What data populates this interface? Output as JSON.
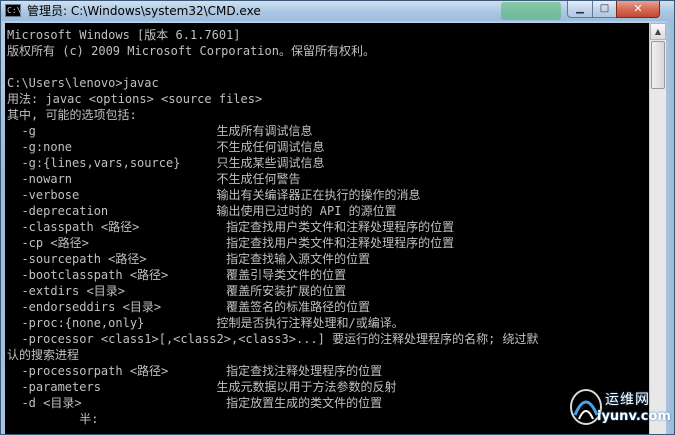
{
  "window": {
    "title": "管理员: C:\\Windows\\system32\\CMD.exe",
    "icon_label": "C:\\",
    "buttons": {
      "minimize_glyph": "▁",
      "maximize_glyph": "□",
      "close_glyph": "✕"
    }
  },
  "console": {
    "lines": [
      "Microsoft Windows [版本 6.1.7601]",
      "版权所有 (c) 2009 Microsoft Corporation。保留所有权利。",
      "",
      "C:\\Users\\lenovo>javac",
      "用法: javac <options> <source files>",
      "其中, 可能的选项包括:",
      "  -g                         生成所有调试信息",
      "  -g:none                    不生成任何调试信息",
      "  -g:{lines,vars,source}     只生成某些调试信息",
      "  -nowarn                    不生成任何警告",
      "  -verbose                   输出有关编译器正在执行的操作的消息",
      "  -deprecation               输出使用已过时的 API 的源位置",
      "  -classpath <路径>            指定查找用户类文件和注释处理程序的位置",
      "  -cp <路径>                   指定查找用户类文件和注释处理程序的位置",
      "  -sourcepath <路径>           指定查找输入源文件的位置",
      "  -bootclasspath <路径>        覆盖引导类文件的位置",
      "  -extdirs <目录>              覆盖所安装扩展的位置",
      "  -endorseddirs <目录>         覆盖签名的标准路径的位置",
      "  -proc:{none,only}          控制是否执行注释处理和/或编译。",
      "  -processor <class1>[,<class2>,<class3>...] 要运行的注释处理程序的名称; 绕过默",
      "认的搜索进程",
      "  -processorpath <路径>        指定查找注释处理程序的位置",
      "  -parameters                生成元数据以用于方法参数的反射",
      "  -d <目录>                    指定放置生成的类文件的位置",
      "          半:"
    ]
  },
  "scrollbar": {
    "up_glyph": "▲"
  },
  "watermark": {
    "cn_text": "运维网",
    "url_text": "iyunv.com"
  }
}
